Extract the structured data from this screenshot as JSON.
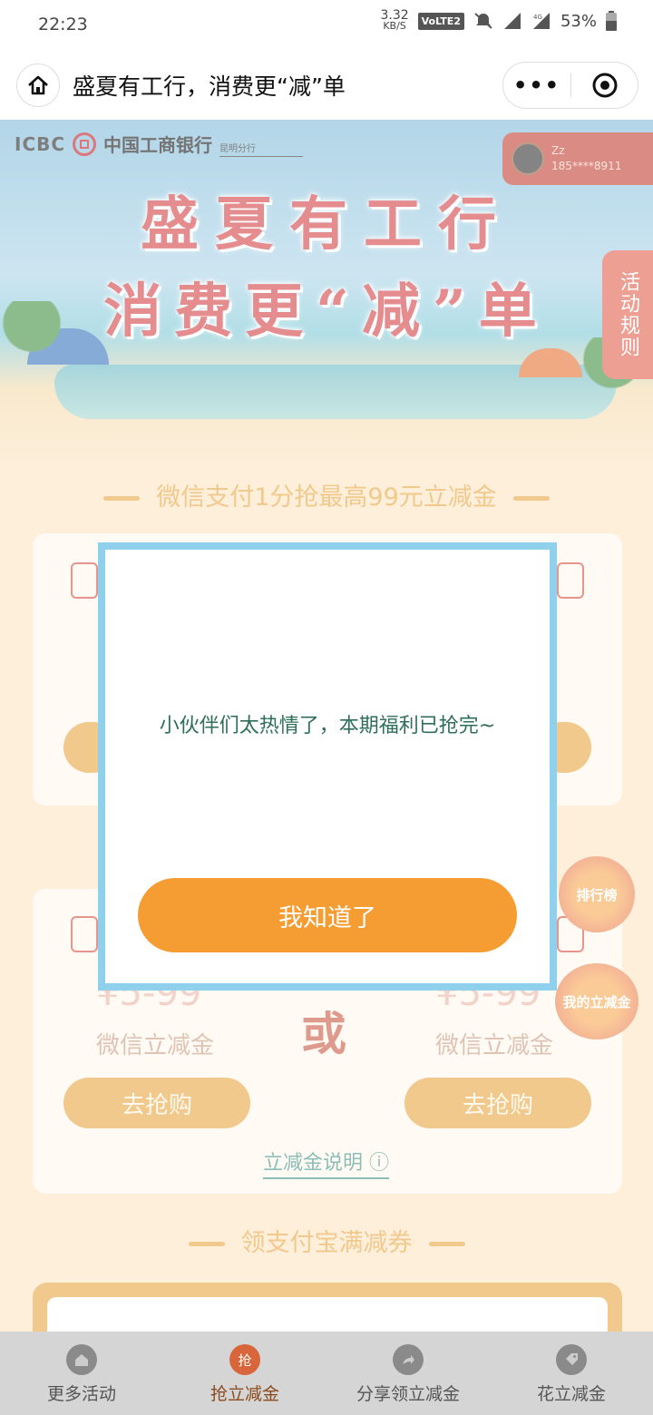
{
  "status_bar": {
    "time": "22:23",
    "net_speed": "3.32",
    "net_unit": "KB/S",
    "volte": "VoLTE2",
    "network": "4G",
    "battery": "53%"
  },
  "nav": {
    "title": "盛夏有工行，消费更“减”单",
    "more": "•••"
  },
  "banner": {
    "bank_en": "ICBC",
    "bank_cn": "中国工商银行",
    "branch": "昆明分行",
    "user_name": "Zz",
    "user_phone": "185****8911",
    "title_line1": "盛夏有工行",
    "title_line2": "消费更“减”单",
    "rules": "活动规则"
  },
  "section1": {
    "title": "微信支付1分抢最高99元立减金"
  },
  "offers": {
    "price": "¥5-99",
    "label": "微信立减金",
    "or": "或",
    "buy": "去抢购",
    "explain": "立减金说明"
  },
  "section2": {
    "title": "领支付宝满减券"
  },
  "floating": {
    "ranking": "排行榜",
    "my_cash": "我的立减金"
  },
  "tabs": [
    {
      "label": "更多活动",
      "icon": "home-icon",
      "active": false
    },
    {
      "label": "抢立减金",
      "icon": "grab-icon",
      "icon_text": "抢",
      "active": true
    },
    {
      "label": "分享领立减金",
      "icon": "share-icon",
      "active": false
    },
    {
      "label": "花立减金",
      "icon": "tag-icon",
      "active": false
    }
  ],
  "modal": {
    "message": "小伙伴们太热情了，本期福利已抢完~",
    "button": "我知道了"
  },
  "colors": {
    "accent_orange": "#f59d33",
    "modal_border": "#8fd0ec",
    "message_text": "#2f6e5b"
  }
}
